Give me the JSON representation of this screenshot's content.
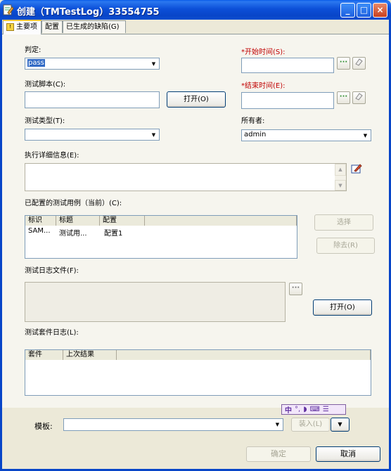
{
  "window": {
    "title": "创建（TMTestLog）33554755",
    "buttons": {
      "minimize": "_",
      "maximize": "□",
      "close": "×"
    }
  },
  "tabs": [
    {
      "label": "主要项",
      "active": true
    },
    {
      "label": "配置",
      "active": false
    },
    {
      "label": "已生成的缺陷(G)",
      "active": false
    }
  ],
  "form": {
    "verdict_label": "判定:",
    "verdict_value": "pass",
    "start_time_label": "*开始时间(S):",
    "start_time_value": "",
    "end_time_label": "*结束时间(E):",
    "end_time_value": "",
    "test_script_label": "测试脚本(C):",
    "test_script_value": "",
    "open_button": "打开(O)",
    "test_type_label": "测试类型(T):",
    "test_type_value": "",
    "owner_label": "所有者:",
    "owner_value": "admin",
    "details_label": "执行详细信息(E):",
    "details_value": "",
    "ellipsis": "···"
  },
  "testcases": {
    "label": "已配置的测试用例（当前）(C):",
    "columns": [
      "标识",
      "标题",
      "配置"
    ],
    "rows": [
      [
        "SAM...",
        "测试用...",
        "配置1"
      ]
    ],
    "select_button": "选择",
    "remove_button": "除去(R)"
  },
  "logfile": {
    "label": "测试日志文件(F):",
    "open_button": "打开(O)"
  },
  "suite_log": {
    "label": "测试套件日志(L):",
    "columns": [
      "套件",
      "上次结果"
    ]
  },
  "footer": {
    "template_label": "模板:",
    "template_value": "",
    "load_button": "装入(L)",
    "ok_button": "确定",
    "cancel_button": "取消",
    "ime_text": "中"
  },
  "colors": {
    "titlebar": "#0845C8",
    "required": "#C00000",
    "selection": "#316AC5"
  }
}
